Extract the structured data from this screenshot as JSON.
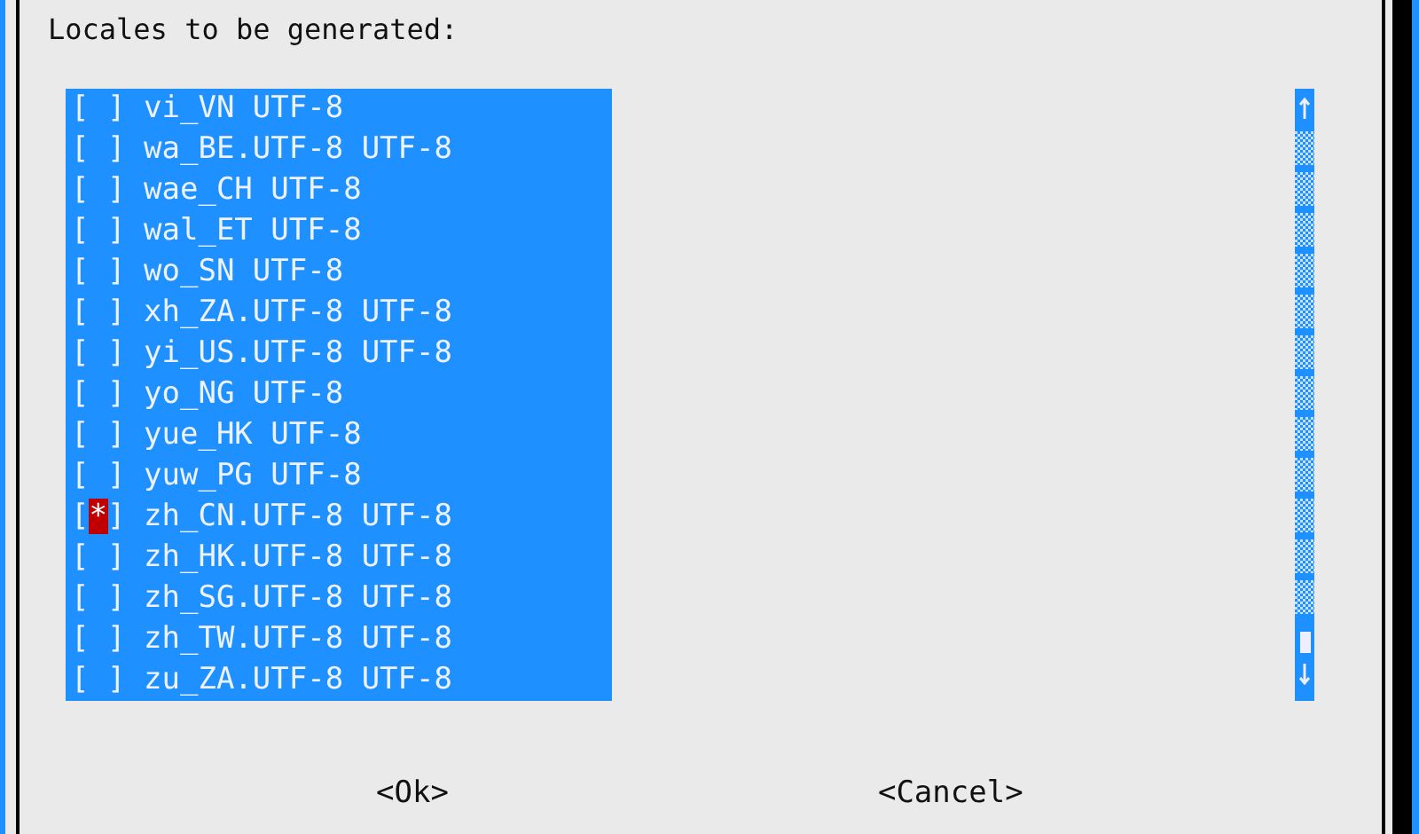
{
  "dialog": {
    "prompt": "Locales to be generated:"
  },
  "checkbox": {
    "open": "[",
    "close": "]",
    "mark": "*"
  },
  "locales": [
    {
      "label": "vi_VN UTF-8",
      "checked": false
    },
    {
      "label": "wa_BE.UTF-8 UTF-8",
      "checked": false
    },
    {
      "label": "wae_CH UTF-8",
      "checked": false
    },
    {
      "label": "wal_ET UTF-8",
      "checked": false
    },
    {
      "label": "wo_SN UTF-8",
      "checked": false
    },
    {
      "label": "xh_ZA.UTF-8 UTF-8",
      "checked": false
    },
    {
      "label": "yi_US.UTF-8 UTF-8",
      "checked": false
    },
    {
      "label": "yo_NG UTF-8",
      "checked": false
    },
    {
      "label": "yue_HK UTF-8",
      "checked": false
    },
    {
      "label": "yuw_PG UTF-8",
      "checked": false
    },
    {
      "label": "zh_CN.UTF-8 UTF-8",
      "checked": true
    },
    {
      "label": "zh_HK.UTF-8 UTF-8",
      "checked": false
    },
    {
      "label": "zh_SG.UTF-8 UTF-8",
      "checked": false
    },
    {
      "label": "zh_TW.UTF-8 UTF-8",
      "checked": false
    },
    {
      "label": "zu_ZA.UTF-8 UTF-8",
      "checked": false
    }
  ],
  "buttons": [
    "<Ok>",
    "<Cancel>"
  ]
}
